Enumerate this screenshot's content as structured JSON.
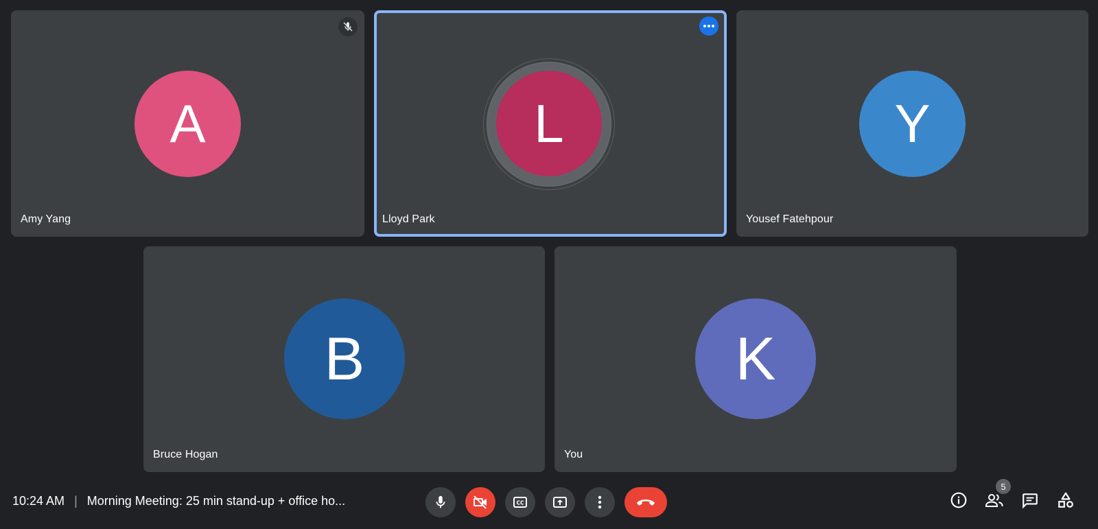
{
  "participants": [
    {
      "name": "Amy Yang",
      "initial": "A",
      "color": "#e0527e",
      "muted": true,
      "speaking": false
    },
    {
      "name": "Lloyd Park",
      "initial": "L",
      "color": "#b72d5c",
      "muted": false,
      "speaking": true
    },
    {
      "name": "Yousef Fatehpour",
      "initial": "Y",
      "color": "#3b87cc",
      "muted": false,
      "speaking": false
    },
    {
      "name": "Bruce Hogan",
      "initial": "B",
      "color": "#215a98",
      "muted": false,
      "speaking": false
    },
    {
      "name": "You",
      "initial": "K",
      "color": "#5f6cbb",
      "muted": false,
      "speaking": false
    }
  ],
  "meeting": {
    "time": "10:24 AM",
    "title": "Morning Meeting: 25 min stand-up + office ho..."
  },
  "controls": {
    "microphone": "microphone-icon",
    "camera": "camera-off-icon",
    "captions": "closed-captions-icon",
    "present": "present-screen-icon",
    "more": "more-vert-icon",
    "hangup": "hang-up-icon"
  },
  "tools": {
    "people_count": "5"
  },
  "colors": {
    "background": "#202124",
    "tile": "#3c4043",
    "active_border": "#8ab4f8",
    "danger": "#ea4335",
    "accent": "#1a73e8"
  }
}
